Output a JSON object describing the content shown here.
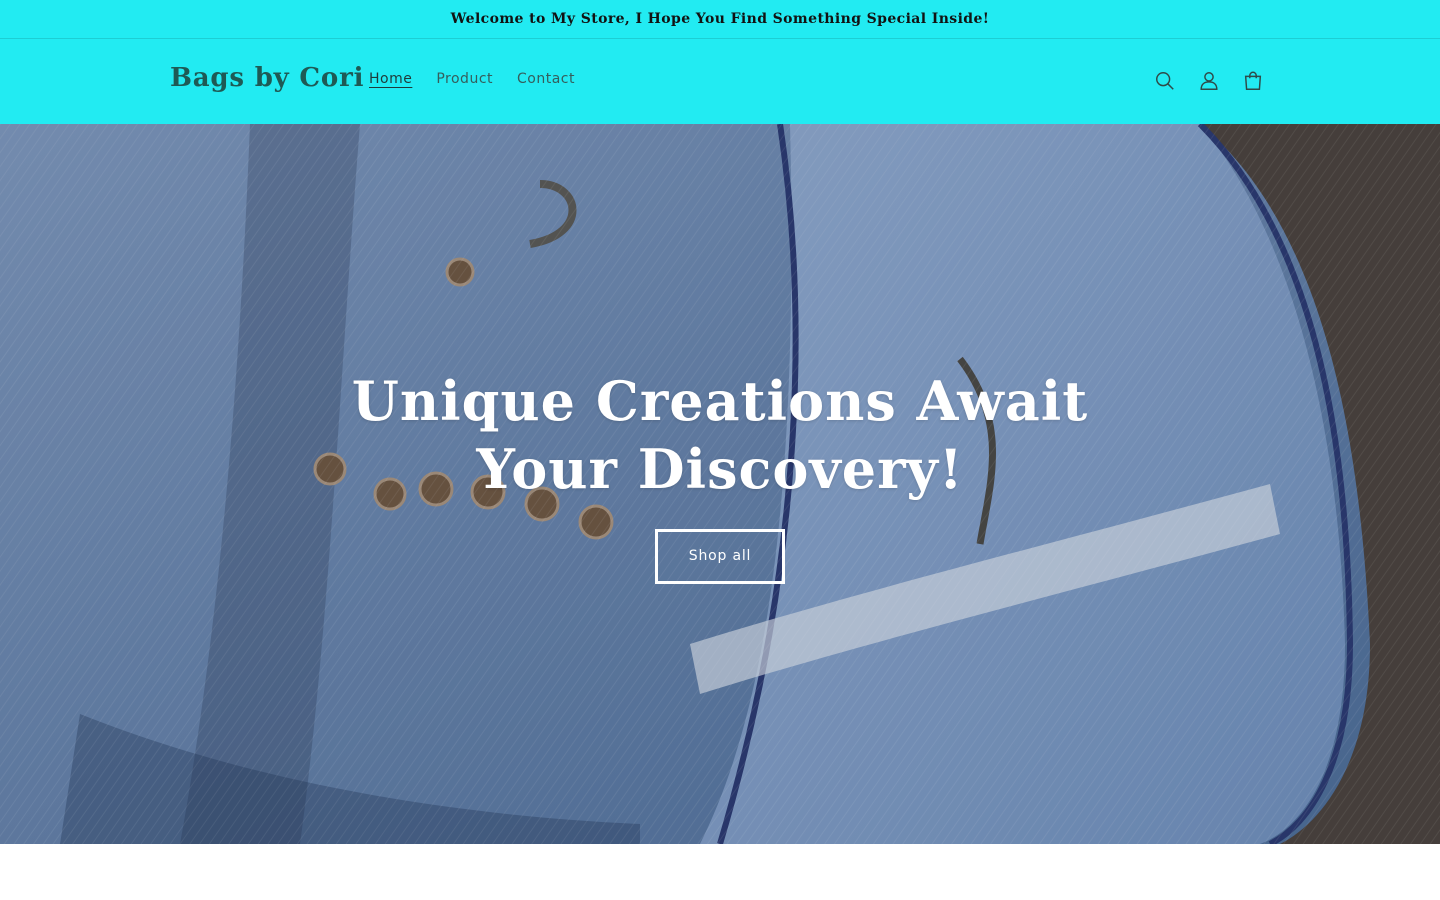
{
  "announcement": {
    "text": "Welcome to My Store, I Hope You Find Something Special Inside!"
  },
  "header": {
    "logo": "Bags by Cori",
    "nav": [
      {
        "label": "Home",
        "active": true
      },
      {
        "label": "Product",
        "active": false
      },
      {
        "label": "Contact",
        "active": false
      }
    ],
    "icons": [
      "search-icon",
      "account-icon",
      "cart-icon"
    ]
  },
  "hero": {
    "title": "Unique Creations Await Your Discovery!",
    "button_label": "Shop all"
  },
  "colors": {
    "header_bg": "#22ebf2",
    "logo": "#1e5a55",
    "hero_text": "#ffffff"
  }
}
